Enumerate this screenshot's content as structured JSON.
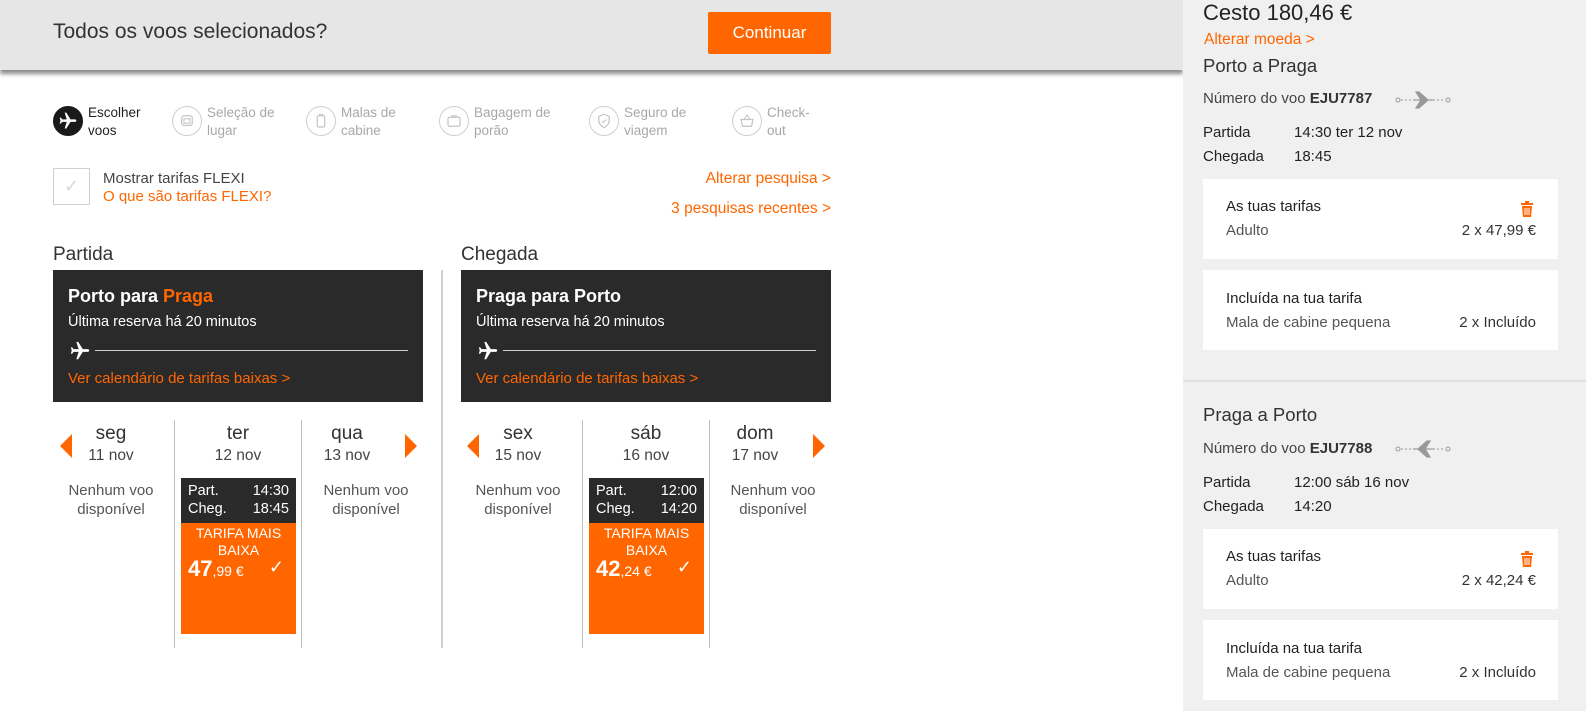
{
  "topbar": {
    "title": "Todos os voos selecionados?",
    "continue_label": "Continuar"
  },
  "steps": [
    {
      "line1": "Escolher",
      "line2": "voos",
      "icon": "plane-icon",
      "active": true
    },
    {
      "line1": "Seleção de",
      "line2": "lugar",
      "icon": "seat-icon",
      "active": false
    },
    {
      "line1": "Malas de",
      "line2": "cabine",
      "icon": "cabin-bag-icon",
      "active": false
    },
    {
      "line1": "Bagagem de",
      "line2": "porão",
      "icon": "hold-bag-icon",
      "active": false
    },
    {
      "line1": "Seguro de",
      "line2": "viagem",
      "icon": "shield-icon",
      "active": false
    },
    {
      "line1": "Check-",
      "line2": "out",
      "icon": "basket-icon",
      "active": false
    }
  ],
  "flexi": {
    "label": "Mostrar tarifas FLEXI",
    "link": "O que são tarifas FLEXI?"
  },
  "links": {
    "alterar_pesquisa": "Alterar pesquisa >",
    "pesquisas_recentes": "3 pesquisas recentes >"
  },
  "outbound": {
    "heading": "Partida",
    "route_prefix": "Porto para ",
    "route_dest": "Praga",
    "last_booking": "Última reserva há 20 minutos",
    "calendar_link": "Ver calendário de tarifas baixas >",
    "days": [
      {
        "name": "seg",
        "date": "11 nov",
        "no_flight": "Nenhum voo disponível"
      },
      {
        "name": "ter",
        "date": "12 nov"
      },
      {
        "name": "qua",
        "date": "13 nov",
        "no_flight": "Nenhum voo disponível"
      }
    ],
    "fare": {
      "dep_label": "Part.",
      "dep_time": "14:30",
      "arr_label": "Cheg.",
      "arr_time": "18:45",
      "tag": "TARIFA MAIS BAIXA",
      "price_int": "47",
      "price_dec": ",99 €"
    }
  },
  "inbound": {
    "heading": "Chegada",
    "route": "Praga para Porto",
    "last_booking": "Última reserva há 20 minutos",
    "calendar_link": "Ver calendário de tarifas baixas >",
    "days": [
      {
        "name": "sex",
        "date": "15 nov",
        "no_flight": "Nenhum voo disponível"
      },
      {
        "name": "sáb",
        "date": "16 nov"
      },
      {
        "name": "dom",
        "date": "17 nov",
        "no_flight": "Nenhum voo disponível"
      }
    ],
    "fare": {
      "dep_label": "Part.",
      "dep_time": "12:00",
      "arr_label": "Cheg.",
      "arr_time": "14:20",
      "tag": "TARIFA MAIS BAIXA",
      "price_int": "42",
      "price_dec": ",24 €"
    }
  },
  "basket": {
    "total": "Cesto 180,46 €",
    "change_currency": "Alterar moeda >",
    "legs": [
      {
        "title": "Porto a Praga",
        "flight_label": "Número do voo",
        "flight_no": "EJU7787",
        "dep_label": "Partida",
        "dep_value": "14:30 ter 12 nov",
        "arr_label": "Chegada",
        "arr_value": "18:45",
        "fares_title": "As tuas tarifas",
        "passenger": "Adulto",
        "fare_value": "2 x 47,99 €",
        "included_title": "Incluída na tua tarifa",
        "included_item": "Mala de cabine pequena",
        "included_value": "2 x Incluído"
      },
      {
        "title": "Praga a Porto",
        "flight_label": "Número do voo",
        "flight_no": "EJU7788",
        "dep_label": "Partida",
        "dep_value": "12:00 sáb 16 nov",
        "arr_label": "Chegada",
        "arr_value": "14:20",
        "fares_title": "As tuas tarifas",
        "passenger": "Adulto",
        "fare_value": "2 x 42,24 €",
        "included_title": "Incluída na tua tarifa",
        "included_item": "Mala de cabine pequena",
        "included_value": "2 x Incluído"
      }
    ]
  },
  "colors": {
    "accent": "#ff6600",
    "dark": "#2a2a2a",
    "panel": "#f0f0f0"
  }
}
